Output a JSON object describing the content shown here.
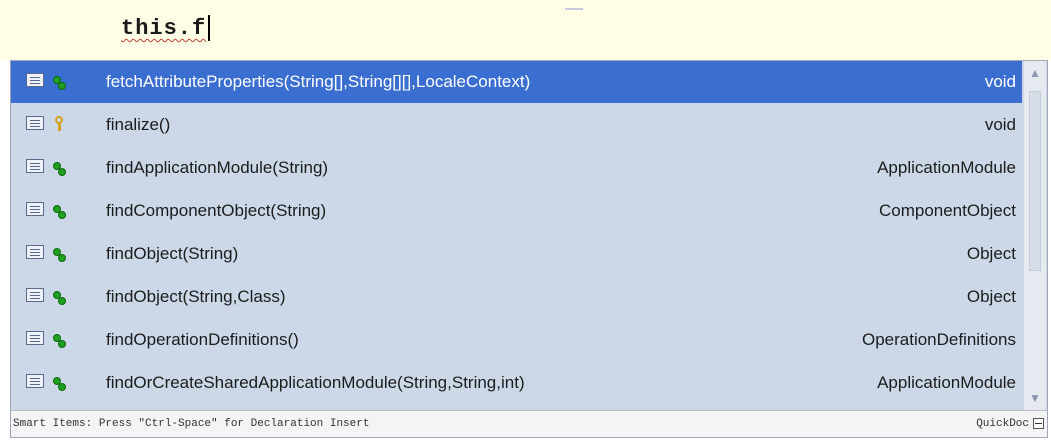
{
  "editor": {
    "code_line": "this.f"
  },
  "completion": {
    "items": [
      {
        "method": "fetchAttributeProperties(String[],String[][],LocaleContext)",
        "return_type": "void",
        "icon": "method-icon",
        "selected": true
      },
      {
        "method": "finalize()",
        "return_type": "void",
        "icon": "key-icon",
        "selected": false
      },
      {
        "method": "findApplicationModule(String)",
        "return_type": "ApplicationModule",
        "icon": "method-icon",
        "selected": false
      },
      {
        "method": "findComponentObject(String)",
        "return_type": "ComponentObject",
        "icon": "method-icon",
        "selected": false
      },
      {
        "method": "findObject(String)",
        "return_type": "Object",
        "icon": "method-icon",
        "selected": false
      },
      {
        "method": "findObject(String,Class)",
        "return_type": "Object",
        "icon": "method-icon",
        "selected": false
      },
      {
        "method": "findOperationDefinitions()",
        "return_type": "OperationDefinitions",
        "icon": "method-icon",
        "selected": false
      },
      {
        "method": "findOrCreateSharedApplicationModule(String,String,int)",
        "return_type": "ApplicationModule",
        "icon": "method-icon",
        "selected": false
      }
    ]
  },
  "statusbar": {
    "hint": "Smart Items: Press \"Ctrl-Space\" for Declaration Insert",
    "quickdoc": "QuickDoc"
  },
  "colors": {
    "selection": "#3a6ed0",
    "list_background": "#ccd8e8",
    "editor_background": "#fffde6"
  }
}
